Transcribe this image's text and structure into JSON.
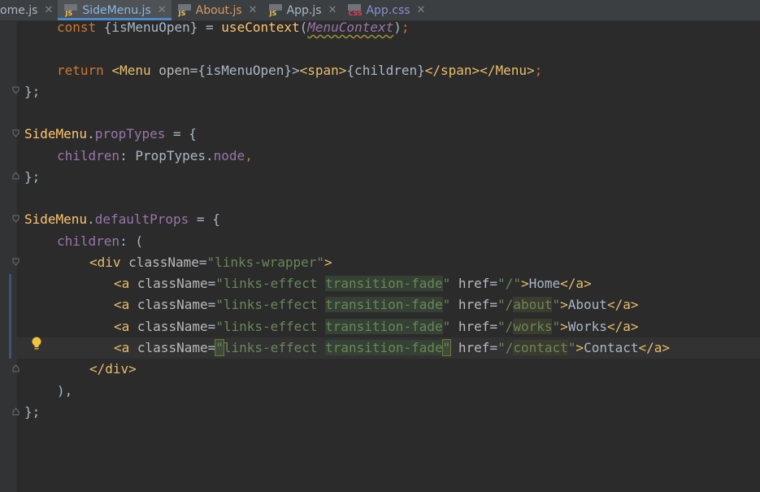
{
  "tabs": [
    {
      "label": "ome.js",
      "icon": "js-file-icon",
      "type": "js",
      "active": false,
      "first": true
    },
    {
      "label": "SideMenu.js",
      "icon": "js-file-icon",
      "type": "js",
      "active": true
    },
    {
      "label": "About.js",
      "icon": "js-file-icon",
      "type": "js",
      "active": false,
      "modified": true
    },
    {
      "label": "App.js",
      "icon": "js-file-icon",
      "type": "js",
      "active": false
    },
    {
      "label": "App.css",
      "icon": "css-file-icon",
      "type": "css",
      "active": false
    }
  ],
  "icon_text": {
    "js": "JS",
    "css": "CSS"
  },
  "close_glyph": "✕",
  "code": {
    "l1": {
      "a": "const ",
      "b": "{isMenuOpen} = ",
      "c": "useContext",
      "d": "(",
      "e": "MenuContext",
      "f": ")",
      "g": ";"
    },
    "l3": {
      "a": "return ",
      "b": "<Menu ",
      "c": "open",
      "d": "={isMenuOpen}>",
      "e": "<span>",
      "f": "{children}",
      "g": "</span>",
      "h": "</Menu>",
      "i": ";"
    },
    "l4": {
      "a": "};"
    },
    "l6": {
      "a": "SideMenu",
      "b": ".",
      "c": "propTypes",
      "d": " = {"
    },
    "l7": {
      "a": "children",
      "b": ": PropTypes.",
      "c": "node",
      "d": ","
    },
    "l8": {
      "a": "};"
    },
    "l10": {
      "a": "SideMenu",
      "b": ".",
      "c": "defaultProps",
      "d": " = {"
    },
    "l11": {
      "a": "children",
      "b": ": ("
    },
    "l12": {
      "a": "<div ",
      "b": "className",
      "c": "=",
      "d": "\"links-wrapper\"",
      "e": ">"
    },
    "l13": {
      "a": "<a ",
      "b": "className",
      "c": "=",
      "d": "\"links-effect ",
      "e": "transition-fade",
      "f": "\" ",
      "g": "href",
      "h": "=",
      "i": "\"/\"",
      "j": ">",
      "k": "Home",
      "l": "</a>"
    },
    "l14": {
      "a": "<a ",
      "b": "className",
      "c": "=",
      "d": "\"links-effect ",
      "e": "transition-fade",
      "f": "\" ",
      "g": "href",
      "h": "=",
      "i": "\"/",
      "j": "about",
      "k": "\"",
      "m": ">",
      "n": "About",
      "o": "</a>"
    },
    "l15": {
      "a": "<a ",
      "b": "className",
      "c": "=",
      "d": "\"links-effect ",
      "e": "transition-fade",
      "f": "\" ",
      "g": "href",
      "h": "=",
      "i": "\"/",
      "j": "works",
      "k": "\"",
      "m": ">",
      "n": "Works",
      "o": "</a>"
    },
    "l16": {
      "a": "<a ",
      "b": "className",
      "c": "=",
      "q": "\"",
      "d": "links-effect ",
      "e": "transition-fade",
      "f": "\"",
      "s": " ",
      "g": "href",
      "h": "=",
      "i": "\"/",
      "j": "contact",
      "k": "\"",
      "m": ">",
      "n": "Contact",
      "o": "</a>"
    },
    "l17": {
      "a": "</div>"
    },
    "l18": {
      "a": "),"
    },
    "l19": {
      "a": "};"
    }
  }
}
